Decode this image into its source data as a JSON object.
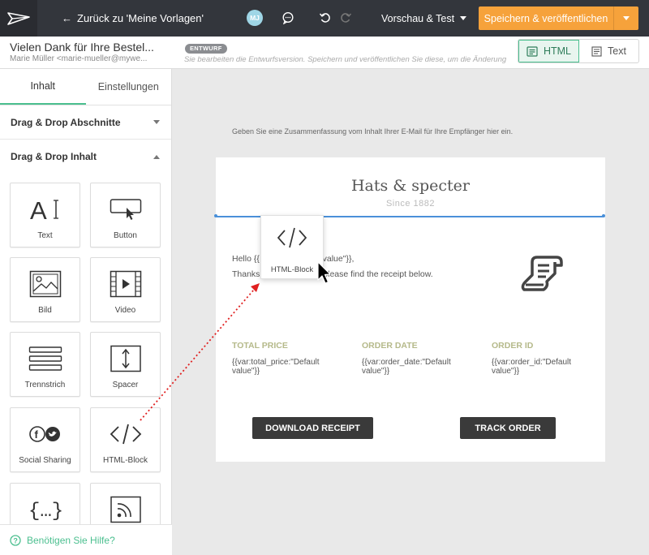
{
  "topbar": {
    "back_label": "Zurück zu 'Meine Vorlagen'",
    "avatar_initials": "MJ",
    "preview_label": "Vorschau & Test",
    "save_label": "Speichern & veröffentlichen"
  },
  "subbar": {
    "email_title": "Vielen Dank für Ihre Bestel...",
    "email_from": "Marie Müller <marie-mueller@mywe...",
    "draft_badge": "ENTWURF",
    "draft_note": "Sie bearbeiten die Entwurfsversion. Speichern und veröffentlichen Sie diese, um die Änderung",
    "mode_html": "HTML",
    "mode_text": "Text"
  },
  "sidebar": {
    "tabs": [
      "Inhalt",
      "Einstellungen"
    ],
    "section_sections": "Drag & Drop Abschnitte",
    "section_content": "Drag & Drop Inhalt",
    "tiles": [
      {
        "label": "Text",
        "icon": "text-icon"
      },
      {
        "label": "Button",
        "icon": "button-icon"
      },
      {
        "label": "Bild",
        "icon": "image-icon"
      },
      {
        "label": "Video",
        "icon": "video-icon"
      },
      {
        "label": "Trennstrich",
        "icon": "divider-icon"
      },
      {
        "label": "Spacer",
        "icon": "spacer-icon"
      },
      {
        "label": "Social Sharing",
        "icon": "social-icon"
      },
      {
        "label": "HTML-Block",
        "icon": "code-icon"
      },
      {
        "label": "",
        "icon": "braces-icon"
      },
      {
        "label": "",
        "icon": "rss-icon"
      }
    ],
    "help_label": "Benötigen Sie Hilfe?"
  },
  "canvas": {
    "summary_text": "Geben Sie eine Zusammenfassung vom Inhalt Ihrer E-Mail für Ihre Empfänger hier ein.",
    "brand_name": "Hats & specter",
    "since": "Since 1882",
    "body_line1_a": "Hello {{",
    "body_line1_b": "fault value\"}},",
    "body_line2_a": "Thanks",
    "body_line2_b": ", please find the receipt below.",
    "columns": [
      {
        "title": "TOTAL PRICE",
        "value": "{{var:total_price:\"Default value\"}}"
      },
      {
        "title": "ORDER DATE",
        "value": "{{var:order_date:\"Default value\"}}"
      },
      {
        "title": "ORDER ID",
        "value": "{{var:order_id:\"Default value\"}}"
      }
    ],
    "button_download": "DOWNLOAD RECEIPT",
    "button_track": "TRACK ORDER"
  },
  "drag_ghost": {
    "label": "HTML-Block",
    "icon": "code-icon"
  },
  "colors": {
    "topbar_bg": "#33363c",
    "accent_orange": "#f6a23b",
    "accent_green": "#4bbf8f",
    "drop_line": "#4a90d9",
    "column_title": "#b5b98a",
    "drag_arrow": "#e02020"
  }
}
